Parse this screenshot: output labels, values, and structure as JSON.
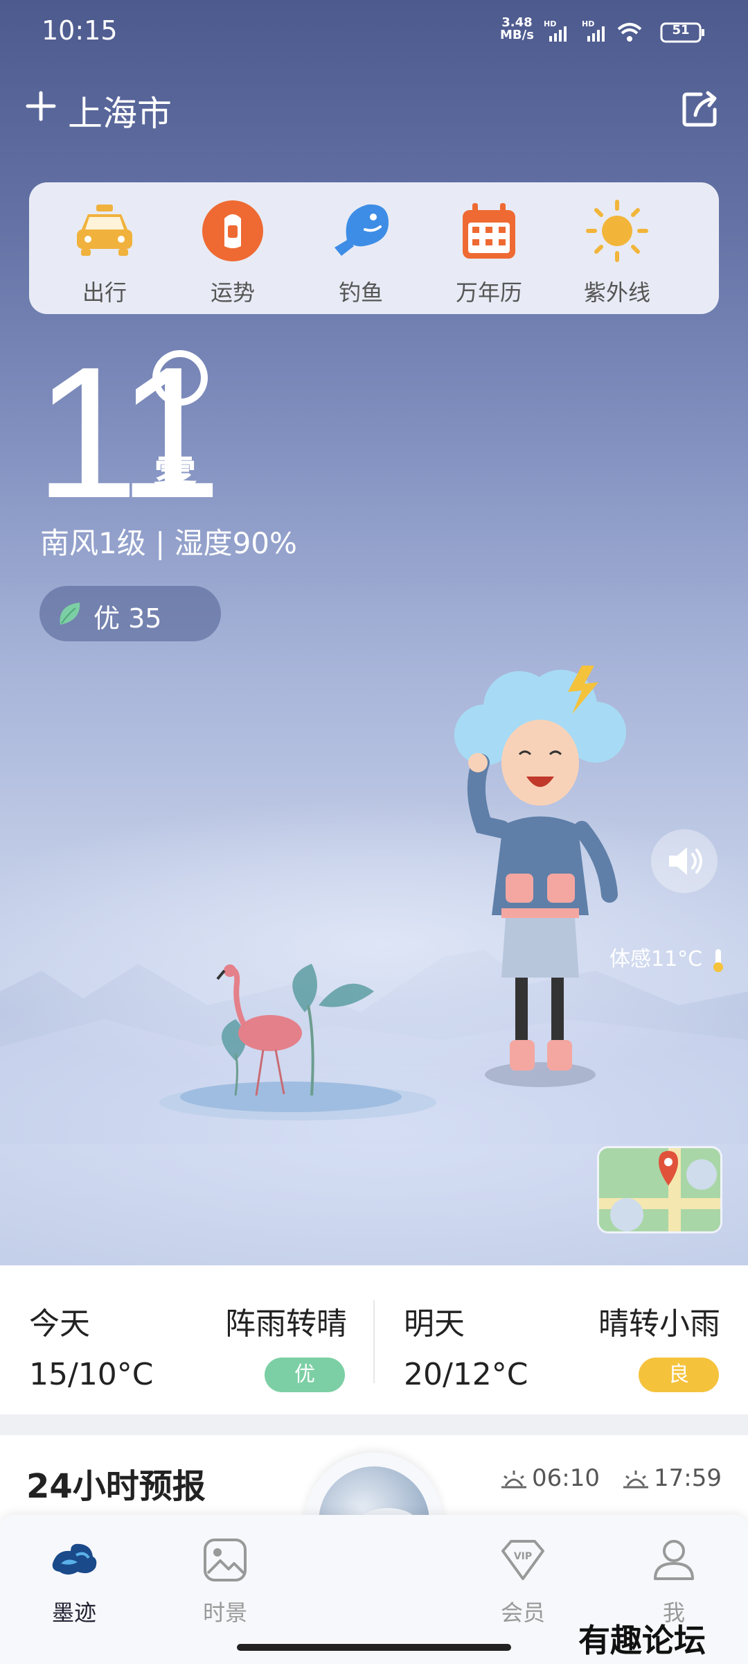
{
  "status_bar": {
    "time": "10:15",
    "net_speed_top": "3.48",
    "net_speed_bottom": "MB/s",
    "hd1": "HD",
    "hd2": "HD",
    "battery": "51"
  },
  "header": {
    "city": "上海市",
    "add_icon": "plus-icon",
    "share_icon": "share-icon"
  },
  "tools": [
    {
      "label": "出行",
      "icon": "taxi-icon",
      "color": "#f0b23c"
    },
    {
      "label": "运势",
      "icon": "fortune-icon",
      "color": "#ee6a32"
    },
    {
      "label": "钓鱼",
      "icon": "fish-icon",
      "color": "#3d8de6"
    },
    {
      "label": "万年历",
      "icon": "calendar-icon",
      "color": "#ee6a32"
    },
    {
      "label": "紫外线",
      "icon": "sun-icon",
      "color": "#f2b53a"
    }
  ],
  "current": {
    "temperature": "11",
    "condition": "雾",
    "wind_humidity": "南风1级 | 湿度90%",
    "aqi": "优 35",
    "feels_like": "体感11°C"
  },
  "forecast": {
    "today": {
      "day": "今天",
      "condition": "阵雨转晴",
      "range": "15/10°C",
      "aqi": "优",
      "aqi_color": "#7ccfa4"
    },
    "tomorrow": {
      "day": "明天",
      "condition": "晴转小雨",
      "range": "20/12°C",
      "aqi": "良",
      "aqi_color": "#f5c23c"
    }
  },
  "hourly": {
    "title": "24小时预报",
    "sunrise": "06:10",
    "sunset": "17:59"
  },
  "nav": [
    {
      "label": "墨迹",
      "icon": "moji-logo-icon",
      "active": true
    },
    {
      "label": "时景",
      "icon": "image-icon",
      "active": false
    },
    {
      "label": "会员",
      "icon": "vip-icon",
      "active": false
    },
    {
      "label": "我",
      "icon": "profile-icon",
      "active": false
    }
  ],
  "watermark": "有趣论坛"
}
